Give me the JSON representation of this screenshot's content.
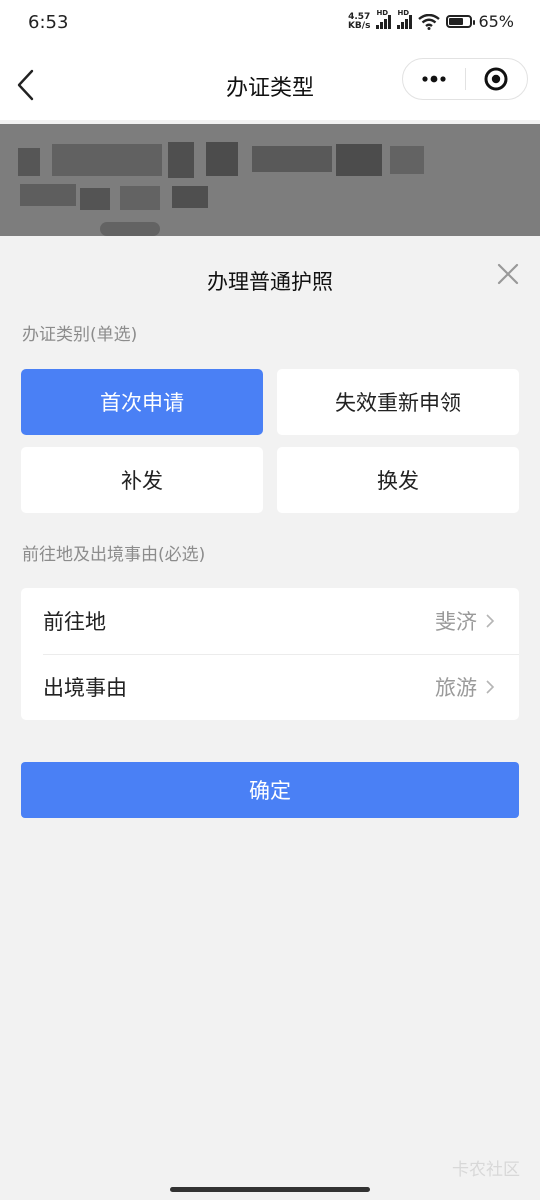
{
  "status_bar": {
    "time": "6:53",
    "net_speed_value": "4.57",
    "net_speed_unit": "KB/s",
    "hd1": "HD",
    "hd2": "HD",
    "battery": "65%"
  },
  "nav": {
    "title": "办证类型"
  },
  "sheet": {
    "title": "办理普通护照",
    "category_label": "办证类别(单选)",
    "options": [
      {
        "label": "首次申请",
        "selected": true
      },
      {
        "label": "失效重新申领",
        "selected": false
      },
      {
        "label": "补发",
        "selected": false
      },
      {
        "label": "换发",
        "selected": false
      }
    ],
    "destination_section_label": "前往地及出境事由(必选)",
    "rows": [
      {
        "label": "前往地",
        "value": "斐济"
      },
      {
        "label": "出境事由",
        "value": "旅游"
      }
    ],
    "confirm_label": "确定"
  },
  "watermark": "卡农社区",
  "colors": {
    "accent": "#4a80f5",
    "overlay": "#7d7d7d"
  }
}
